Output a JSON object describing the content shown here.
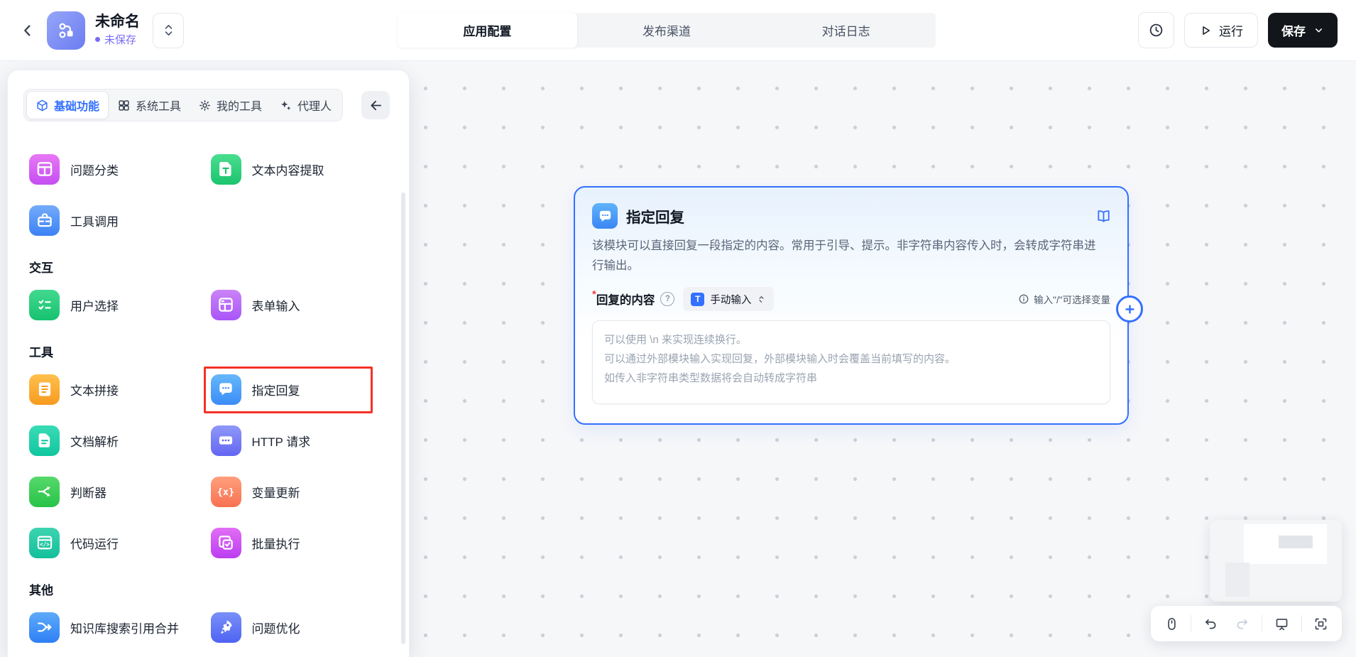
{
  "colors": {
    "accent": "#3370ff",
    "highlight_box": "#f53126",
    "unsaved": "#7a6cf3",
    "canvas_dot": "#cbd0d7",
    "save_button_bg": "#121519"
  },
  "header": {
    "back_icon": "chevron-left-icon",
    "logo_icon": "workflow-logo-icon",
    "title": "未命名",
    "status_text": "未保存",
    "version_selector_icon": "up-down-chevrons-icon",
    "tabs": [
      {
        "label": "应用配置",
        "active": true
      },
      {
        "label": "发布渠道",
        "active": false
      },
      {
        "label": "对话日志",
        "active": false
      }
    ],
    "history_icon": "clock-icon",
    "run_icon": "play-icon",
    "run_label": "运行",
    "save_label": "保存",
    "save_chevron_icon": "chevron-down-icon"
  },
  "palette": {
    "tabs": [
      {
        "label": "基础功能",
        "icon": "cube-icon",
        "active": true
      },
      {
        "label": "系统工具",
        "icon": "grid-icon",
        "active": false
      },
      {
        "label": "我的工具",
        "icon": "gear-icon",
        "active": false
      },
      {
        "label": "代理人",
        "icon": "sparkles-icon",
        "active": false
      }
    ],
    "collapse_icon": "arrow-left-icon",
    "sections": [
      {
        "label": "",
        "items": [
          {
            "label": "问题分类",
            "icon": "classify-icon",
            "glyph": "layout",
            "colors": [
              "#e878f6",
              "#c44ef2"
            ],
            "highlighted": false
          },
          {
            "label": "文本内容提取",
            "icon": "text-extract-icon",
            "glyph": "doc-t",
            "colors": [
              "#4ade8f",
              "#1cc46e"
            ],
            "highlighted": false
          },
          {
            "label": "工具调用",
            "icon": "toolbox-icon",
            "glyph": "toolbox",
            "colors": [
              "#74abf9",
              "#3b82f6"
            ],
            "highlighted": false
          }
        ]
      },
      {
        "label": "交互",
        "items": [
          {
            "label": "用户选择",
            "icon": "user-select-icon",
            "glyph": "checklist",
            "colors": [
              "#41d98e",
              "#17c26f"
            ],
            "highlighted": false
          },
          {
            "label": "表单输入",
            "icon": "form-input-icon",
            "glyph": "form",
            "colors": [
              "#cb83f7",
              "#a855f7"
            ],
            "highlighted": false
          }
        ]
      },
      {
        "label": "工具",
        "items": [
          {
            "label": "文本拼接",
            "icon": "text-concat-icon",
            "glyph": "doc-lines",
            "colors": [
              "#ffc04d",
              "#f79a1f"
            ],
            "highlighted": false
          },
          {
            "label": "指定回复",
            "icon": "reply-icon",
            "glyph": "chat",
            "colors": [
              "#66b8fa",
              "#3b8cf7"
            ],
            "highlighted": true
          },
          {
            "label": "文档解析",
            "icon": "doc-parse-icon",
            "glyph": "doc",
            "colors": [
              "#39dcb6",
              "#10c69e"
            ],
            "highlighted": false
          },
          {
            "label": "HTTP 请求",
            "icon": "http-icon",
            "glyph": "http",
            "colors": [
              "#8f98f9",
              "#6366f1"
            ],
            "highlighted": false
          },
          {
            "label": "判断器",
            "icon": "condition-icon",
            "glyph": "split",
            "colors": [
              "#57d96b",
              "#27c347"
            ],
            "highlighted": false
          },
          {
            "label": "变量更新",
            "icon": "variable-update-icon",
            "glyph": "braces",
            "colors": [
              "#ff9f7d",
              "#f87151"
            ],
            "highlighted": false
          },
          {
            "label": "代码运行",
            "icon": "code-run-icon",
            "glyph": "code",
            "colors": [
              "#3ed4b0",
              "#12bf9a"
            ],
            "highlighted": false
          },
          {
            "label": "批量执行",
            "icon": "batch-run-icon",
            "glyph": "loop",
            "colors": [
              "#e26ef5",
              "#bb3df2"
            ],
            "highlighted": false
          }
        ]
      },
      {
        "label": "其他",
        "items": [
          {
            "label": "知识库搜索引用合并",
            "icon": "kb-merge-icon",
            "glyph": "merge",
            "colors": [
              "#5cabf9",
              "#2f7ff6"
            ],
            "highlighted": false
          },
          {
            "label": "问题优化",
            "icon": "question-optimize-icon",
            "glyph": "rocket",
            "colors": [
              "#7a90f8",
              "#4f63f3"
            ],
            "highlighted": false
          }
        ]
      }
    ]
  },
  "node": {
    "title": "指定回复",
    "icon": "chat-icon",
    "icon_colors": [
      "#5fb3f9",
      "#3a86f6"
    ],
    "doc_icon": "book-icon",
    "description": "该模块可以直接回复一段指定的内容。常用于引导、提示。非字符串内容传入时，会转成字符串进行输出。",
    "field": {
      "required_mark": "*",
      "label": "回复的内容",
      "help_icon": "question-circle-icon",
      "selector": {
        "icon": "type-text-icon",
        "label": "手动输入",
        "chevrons_icon": "up-down-chevrons-icon"
      },
      "hint_icon": "info-circle-icon",
      "hint": "输入\"/\"可选择变量",
      "placeholder": "可以使用 \\n 来实现连续换行。\n可以通过外部模块输入实现回复，外部模块输入时会覆盖当前填写的内容。\n如传入非字符串类型数据将会自动转成字符串",
      "value": ""
    },
    "add_handle_icon": "plus-circle-icon"
  },
  "controls": {
    "toolbar_icons": [
      "mouse-icon",
      "undo-icon",
      "redo-icon",
      "presentation-icon",
      "fit-view-icon"
    ],
    "minimap_parts": [
      "minimap-viewport",
      "minimap-node-rect",
      "minimap-panel-rect"
    ]
  }
}
